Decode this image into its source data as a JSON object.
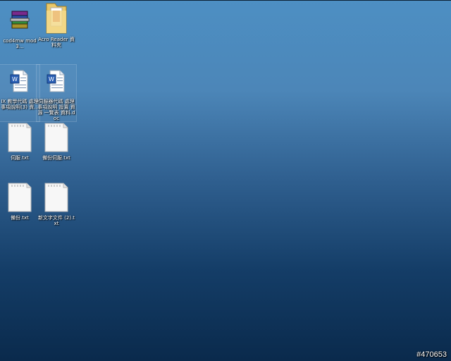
{
  "desktop": {
    "icons": [
      {
        "label": "cod4mw mod3...",
        "icon": "winrar-archive-icon"
      },
      {
        "label": "Acro Reader 資料夾",
        "icon": "folder-icon"
      },
      {
        "label": "IX 教學代碼 處理 事項說明(3) 資...",
        "icon": "word-document-icon"
      },
      {
        "label": "伺服器代碼 處理 事項說明 設置 資 源 一覽表 資料.doc",
        "icon": "word-document-icon"
      },
      {
        "label": "伺服.txt",
        "icon": "text-file-icon"
      },
      {
        "label": "備份伺服.txt",
        "icon": "text-file-icon"
      },
      {
        "label": "備份.txt",
        "icon": "text-file-icon"
      },
      {
        "label": "新文字文件 (2).txt",
        "icon": "text-file-icon"
      }
    ]
  },
  "watermark": "#470653",
  "colors": {
    "desktop_top": "#4d8fc3",
    "desktop_bottom": "#0a2a4c",
    "label_text": "#ffffff"
  }
}
